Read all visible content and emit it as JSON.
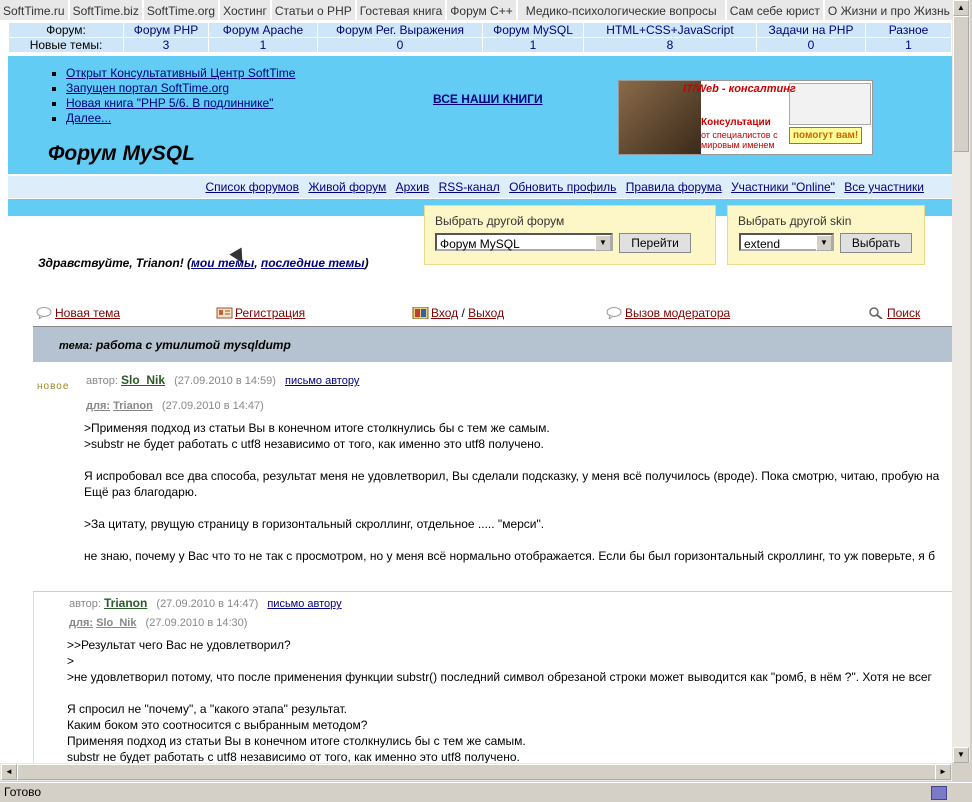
{
  "top_links": [
    "SoftTime.ru",
    "SoftTime.biz",
    "SoftTime.org",
    "Хостинг",
    "Статьи о PHP",
    "Гостевая книга",
    "Форум С++",
    "Медико-психологические вопросы",
    "Сам себе юрист",
    "О Жизни и про Жизнь"
  ],
  "stats": {
    "row1_label": "Форум:",
    "row2_label": "Новые темы:",
    "forums": [
      {
        "name": "Форум PHP",
        "count": "3"
      },
      {
        "name": "Форум Apache",
        "count": "1"
      },
      {
        "name": "Форум Рег. Выражения",
        "count": "0"
      },
      {
        "name": "Форум MySQL",
        "count": "1"
      },
      {
        "name": "HTML+CSS+JavaScript",
        "count": "8"
      },
      {
        "name": "Задачи на PHP",
        "count": "0"
      },
      {
        "name": "Разное",
        "count": "1"
      }
    ]
  },
  "banner": {
    "news": [
      "Открыт Консультативный Центр SoftTime",
      "Запущен портал SoftTime.org",
      "Новая книга \"PHP 5/6. В подлиннике\"",
      "Далее..."
    ],
    "all_books": "ВСЕ НАШИ КНИГИ",
    "forum_title": "Форум MySQL",
    "ad": {
      "line1": "IT/Web - консалтинг",
      "line2": "Консультации",
      "line3": "от специалистов с мировым именем",
      "line4": "помогут вам!"
    }
  },
  "nav": [
    "Список форумов",
    "Живой форум",
    "Архив",
    "RSS-канал",
    "Обновить профиль",
    "Правила форума",
    "Участники \"Online\"",
    "Все участники"
  ],
  "forum_select": {
    "label": "Выбрать другой форум",
    "value": "Форум MySQL",
    "button": "Перейти"
  },
  "skin_select": {
    "label": "Выбрать другой skin",
    "value": "extend",
    "button": "Выбрать"
  },
  "greeting": {
    "text": "Здравствуйте, Trianon! (",
    "my_topics": "мои темы",
    "sep": ", ",
    "last_topics": "последние темы",
    "end": ")"
  },
  "actions": {
    "new_topic": "Новая тема",
    "register": "Регистрация",
    "login": "Вход",
    "slash": " / ",
    "logout": "Выход",
    "moderator": "Вызов модератора",
    "search": "Поиск"
  },
  "topic": {
    "prefix": "тема:",
    "title": "работа с утилитой mysqldump"
  },
  "posts": [
    {
      "new_label": "новое",
      "author_prefix": "автор:",
      "author": "Slo_Nik",
      "date": "(27.09.2010 в 14:59)",
      "mail": "письмо автору",
      "for_prefix": "для:",
      "for_user": "Trianon",
      "for_date": "(27.09.2010 в 14:47)",
      "body": ">Применяя подход из статьи Вы в конечном итоге столкнулись бы с тем же самым.\n>substr не будет работать с utf8 независимо от того, как именно это utf8 получено.\n\nЯ испробовал все два способа, результат меня не удовлетворил, Вы сделали подсказку, у меня всё получилось (вроде). Пока смотрю, читаю, пробую на\nЕщё раз благодарю.\n\n>За цитату, рвущую страницу в горизонтальный скроллинг, отдельное ..... \"мерси\".\n\nне знаю, почему у Вас что то не так с просмотром, но у меня всё нормально отображается. Если бы был горизонтальный скроллинг, то уж поверьте, я б"
    },
    {
      "author_prefix": "автор:",
      "author": "Trianon",
      "date": "(27.09.2010 в 14:47)",
      "mail": "письмо автору",
      "for_prefix": "для:",
      "for_user": "Slo_Nik",
      "for_date": "(27.09.2010 в 14:30)",
      "body": ">>Результат чего Вас не удовлетворил?\n>\n>не удовлетворил потому, что после применения функции substr() последний символ обрезаной строки может выводится как \"ромб, в нём ?\". Хотя не всег\n\nЯ спросил не \"почему\", а \"какого этапа\" результат.\nКаким боком это соотносится с выбранным методом?\nПрименяя подход из статьи Вы в конечном итоге столкнулись бы с тем же самым.\nsubstr не будет работать с utf8 независимо от того, как именно это utf8 получено."
    }
  ],
  "status": "Готово"
}
